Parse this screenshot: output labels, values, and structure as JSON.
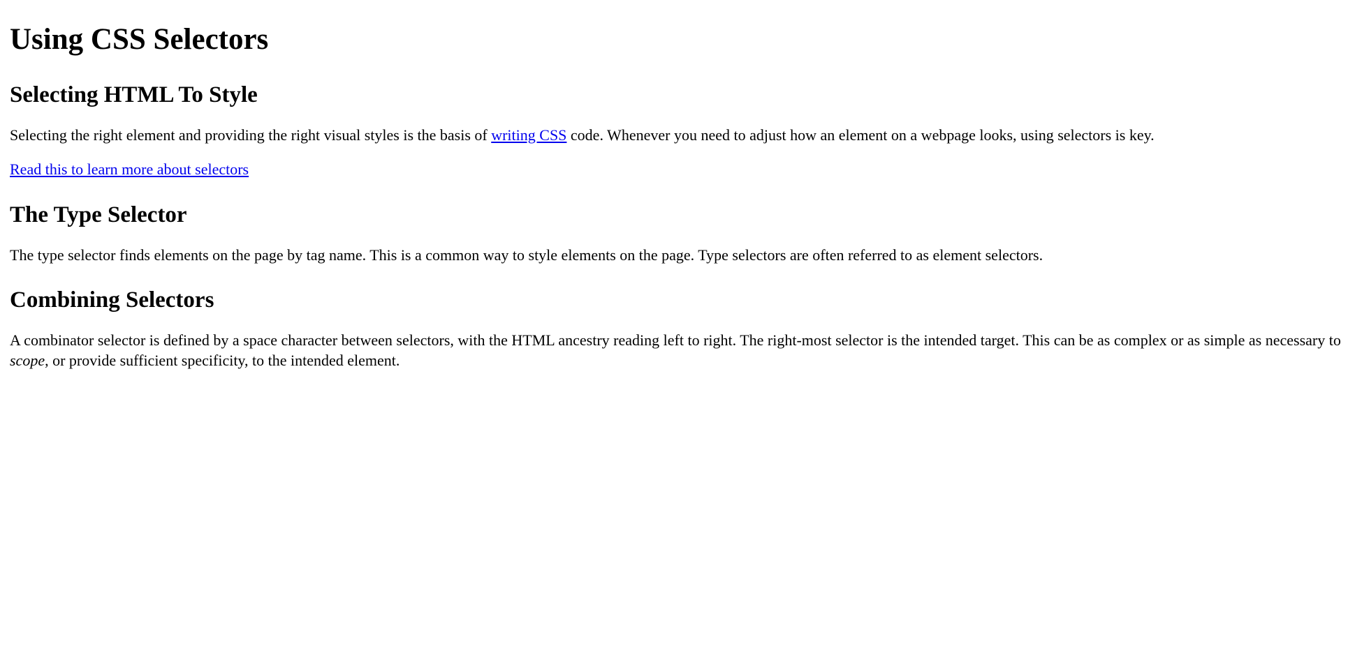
{
  "page": {
    "title": "Using CSS Selectors"
  },
  "sections": {
    "selecting": {
      "heading": "Selecting HTML To Style",
      "para_before": "Selecting the right element and providing the right visual styles is the basis of ",
      "link_text": "writing CSS",
      "para_after": " code. Whenever you need to adjust how an element on a webpage looks, using selectors is key.",
      "more_link": "Read this to learn more about selectors"
    },
    "type_selector": {
      "heading": "The Type Selector",
      "para": "The type selector finds elements on the page by tag name. This is a common way to style elements on the page. Type selectors are often referred to as element selectors."
    },
    "combining": {
      "heading": "Combining Selectors",
      "para_before": "A combinator selector is defined by a space character between selectors, with the HTML ancestry reading left to right. The right-most selector is the intended target. This can be as complex or as simple as necessary to ",
      "em_text": "scope",
      "para_after": ", or provide sufficient specificity, to the intended element."
    }
  }
}
